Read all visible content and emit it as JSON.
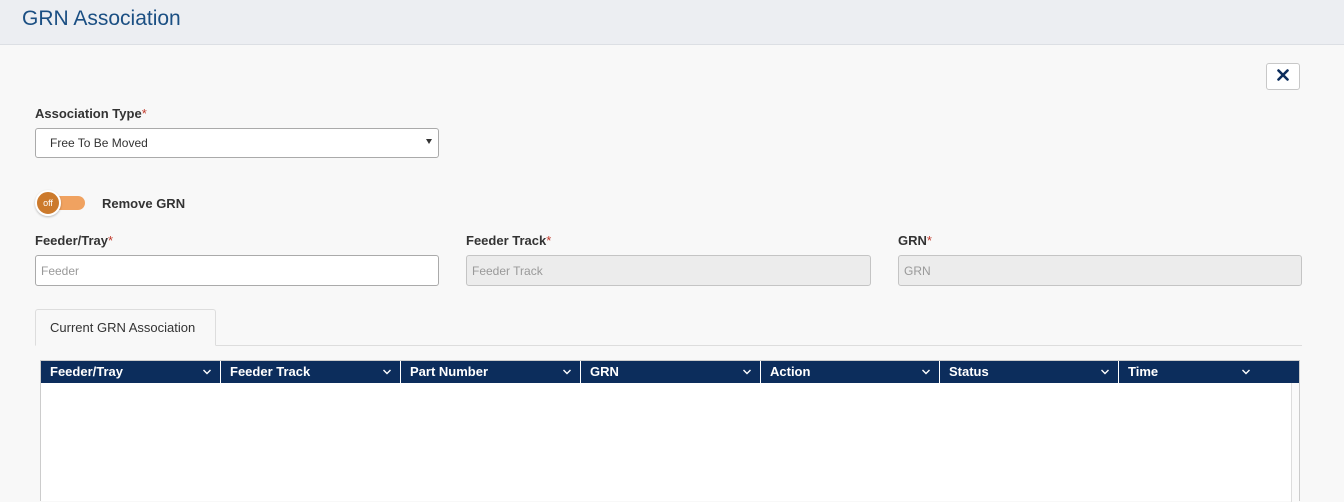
{
  "header": {
    "title": "GRN Association"
  },
  "association_type": {
    "label": "Association Type",
    "required_mark": "*",
    "selected": "Free To Be Moved"
  },
  "remove_grn": {
    "toggle_state": "off",
    "label": "Remove GRN"
  },
  "fields": {
    "feeder_tray": {
      "label": "Feeder/Tray",
      "required_mark": "*",
      "placeholder": "Feeder",
      "value": ""
    },
    "feeder_track": {
      "label": "Feeder Track",
      "required_mark": "*",
      "placeholder": "Feeder Track",
      "value": ""
    },
    "grn": {
      "label": "GRN",
      "required_mark": "*",
      "placeholder": "GRN",
      "value": ""
    }
  },
  "tabs": [
    {
      "label": "Current GRN Association"
    }
  ],
  "grid": {
    "columns": [
      "Feeder/Tray",
      "Feeder Track",
      "Part Number",
      "GRN",
      "Action",
      "Status",
      "Time"
    ],
    "rows": []
  },
  "icons": {
    "close": "close-icon",
    "column_menu": "chevron-down-icon",
    "dropdown": "caret-down-icon"
  },
  "colors": {
    "accent": "#0c2d5c",
    "title": "#1b4f83",
    "toggle": "#cc7a2c",
    "required": "#c0392b"
  }
}
